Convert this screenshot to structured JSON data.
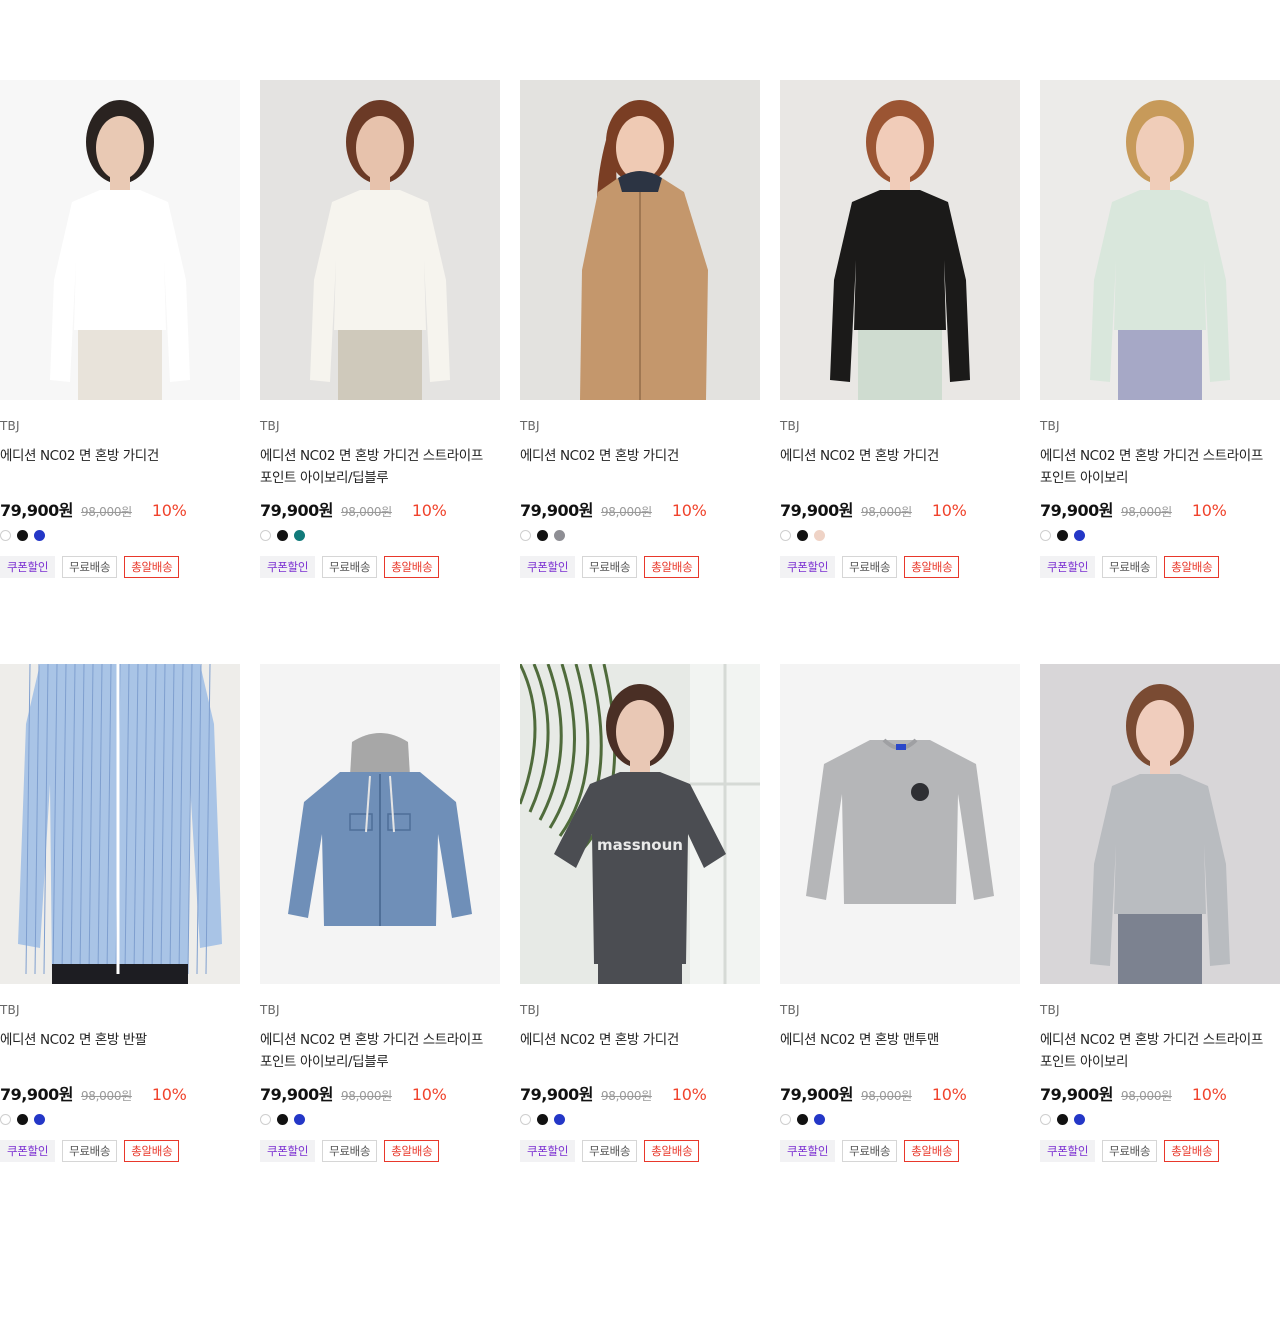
{
  "products": [
    {
      "brand": "TBJ",
      "name": "에디션 NC02 면 혼방 가디건",
      "price": "79,900원",
      "original_price": "98,000원",
      "discount": "10%",
      "colors": [
        "#ffffff",
        "#111111",
        "#2437c7"
      ],
      "image": {
        "bg": "#f7f7f7",
        "garment": "#ffffff",
        "hair": "#2a2320",
        "skin": "#e9c9b4",
        "lower": "#e8e3da",
        "type": "model"
      }
    },
    {
      "brand": "TBJ",
      "name": "에디션 NC02 면 혼방 가디건 스트라이프 포인트 아이보리/딥블루",
      "price": "79,900원",
      "original_price": "98,000원",
      "discount": "10%",
      "colors": [
        "#ffffff",
        "#111111",
        "#117a7a"
      ],
      "image": {
        "bg": "#e4e3e1",
        "garment": "#f6f4ee",
        "hair": "#6b3a26",
        "skin": "#e7c2ac",
        "lower": "#cfc9bb",
        "type": "model"
      }
    },
    {
      "brand": "TBJ",
      "name": "에디션 NC02 면 혼방 가디건",
      "price": "79,900원",
      "original_price": "98,000원",
      "discount": "10%",
      "colors": [
        "#ffffff",
        "#111111",
        "#8e8e94"
      ],
      "image": {
        "bg": "#e3e2df",
        "garment": "#c4976c",
        "hair": "#7a3e24",
        "skin": "#efcab4",
        "lower": "#c4976c",
        "type": "coat"
      }
    },
    {
      "brand": "TBJ",
      "name": "에디션 NC02 면 혼방 가디건",
      "price": "79,900원",
      "original_price": "98,000원",
      "discount": "10%",
      "colors": [
        "#ffffff",
        "#111111",
        "#efd3c6"
      ],
      "image": {
        "bg": "#e9e7e4",
        "garment": "#1b1a19",
        "hair": "#9b5533",
        "skin": "#f1ccb9",
        "lower": "#cfdcd0",
        "type": "model"
      }
    },
    {
      "brand": "TBJ",
      "name": "에디션 NC02 면 혼방 가디건 스트라이프 포인트 아이보리",
      "price": "79,900원",
      "original_price": "98,000원",
      "discount": "10%",
      "colors": [
        "#ffffff",
        "#111111",
        "#2437c7"
      ],
      "image": {
        "bg": "#ecebe9",
        "garment": "#d9e7dc",
        "hair": "#c79a5a",
        "skin": "#f0cdb9",
        "lower": "#a6a8c6",
        "type": "model"
      }
    },
    {
      "brand": "TBJ",
      "name": "에디션 NC02 면 혼방 반팔",
      "price": "79,900원",
      "original_price": "98,000원",
      "discount": "10%",
      "colors": [
        "#ffffff",
        "#111111",
        "#2437c7"
      ],
      "image": {
        "bg": "#eeedea",
        "garment": "#a9c4e6",
        "hair": "#000000",
        "skin": "#e6c2aa",
        "lower": "#1d1d22",
        "type": "shirt"
      }
    },
    {
      "brand": "TBJ",
      "name": "에디션 NC02 면 혼방 가디건 스트라이프 포인트 아이보리/딥블루",
      "price": "79,900원",
      "original_price": "98,000원",
      "discount": "10%",
      "colors": [
        "#ffffff",
        "#111111",
        "#2437c7"
      ],
      "image": {
        "bg": "#f4f4f4",
        "garment": "#6f8fb8",
        "hair": "#a7a7a7",
        "skin": "#000000",
        "lower": "#6f8fb8",
        "type": "jacket"
      }
    },
    {
      "brand": "TBJ",
      "name": "에디션 NC02 면 혼방 가디건",
      "price": "79,900원",
      "original_price": "98,000원",
      "discount": "10%",
      "colors": [
        "#ffffff",
        "#111111",
        "#2437c7"
      ],
      "image": {
        "bg": "#e7eae6",
        "garment": "#4b4d52",
        "hair": "#4a2f25",
        "skin": "#e9c8b5",
        "lower": "#4b4d52",
        "type": "tee",
        "print": "massnoun"
      }
    },
    {
      "brand": "TBJ",
      "name": "에디션 NC02  면 혼방 맨투맨",
      "price": "79,900원",
      "original_price": "98,000원",
      "discount": "10%",
      "colors": [
        "#ffffff",
        "#111111",
        "#2437c7"
      ],
      "image": {
        "bg": "#f4f4f4",
        "garment": "#b5b6b8",
        "hair": "#000000",
        "skin": "#000000",
        "lower": "#b5b6b8",
        "type": "sweat"
      }
    },
    {
      "brand": "TBJ",
      "name": "에디션 NC02 면 혼방 가디건 스트라이프 포인트 아이보리",
      "price": "79,900원",
      "original_price": "98,000원",
      "discount": "10%",
      "colors": [
        "#ffffff",
        "#111111",
        "#2437c7"
      ],
      "image": {
        "bg": "#d8d6d8",
        "garment": "#b9bcc0",
        "hair": "#7a4b33",
        "skin": "#f0cdbd",
        "lower": "#7c8290",
        "type": "model"
      }
    }
  ],
  "tags": {
    "coupon": "쿠폰할인",
    "free_shipping": "무료배송",
    "express": "총알배송"
  }
}
